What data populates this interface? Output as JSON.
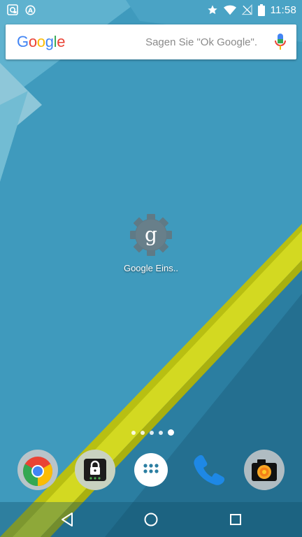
{
  "status_bar": {
    "time": "11:58",
    "left_icons": [
      "sync-account-icon",
      "notification-a-icon"
    ],
    "right_icons": [
      "star-icon",
      "wifi-icon",
      "no-signal-icon",
      "battery-icon"
    ]
  },
  "search_bar": {
    "logo": {
      "letters": [
        "G",
        "o",
        "o",
        "g",
        "l",
        "e"
      ]
    },
    "hint": "Sagen Sie \"Ok Google\".",
    "mic_icon": "microphone-icon"
  },
  "home": {
    "apps": [
      {
        "label": "Google Eins..",
        "icon": "google-settings-gear-icon"
      }
    ],
    "page_count": 5,
    "active_page": 4
  },
  "dock": {
    "apps": [
      {
        "name": "Chrome",
        "icon": "chrome-icon"
      },
      {
        "name": "Lock app",
        "icon": "lock-screen-icon"
      },
      {
        "name": "App drawer",
        "icon": "app-drawer-icon"
      },
      {
        "name": "Phone",
        "icon": "phone-icon"
      },
      {
        "name": "Camera",
        "icon": "camera-icon"
      }
    ]
  },
  "nav_bar": {
    "buttons": [
      "back-icon",
      "home-icon",
      "recents-icon"
    ]
  },
  "colors": {
    "wallpaper_base": "#3a94b8",
    "wallpaper_light": "#4aa5c7",
    "wallpaper_dark": "#1f6e8e",
    "accent_yellow": "#cdd419",
    "google_blue": "#4285f4",
    "google_red": "#ea4335",
    "google_yellow": "#fbbc05",
    "google_green": "#34a853"
  }
}
